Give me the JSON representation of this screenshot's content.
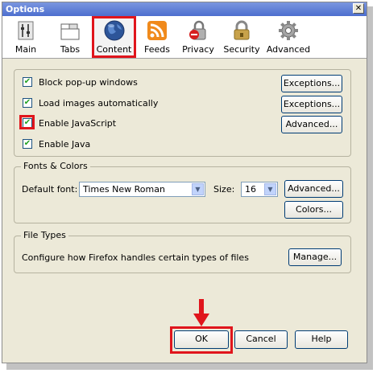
{
  "window": {
    "title": "Options",
    "close_glyph": "✕"
  },
  "toolbar": {
    "panes": [
      {
        "label": "Main",
        "icon": "main-icon"
      },
      {
        "label": "Tabs",
        "icon": "tabs-icon"
      },
      {
        "label": "Content",
        "icon": "content-icon",
        "selected": true
      },
      {
        "label": "Feeds",
        "icon": "feeds-icon"
      },
      {
        "label": "Privacy",
        "icon": "privacy-icon"
      },
      {
        "label": "Security",
        "icon": "security-icon"
      },
      {
        "label": "Advanced",
        "icon": "advanced-icon"
      }
    ]
  },
  "content": {
    "checkboxes": [
      {
        "label": "Block pop-up windows",
        "checked": true
      },
      {
        "label": "Load images automatically",
        "checked": true
      },
      {
        "label": "Enable JavaScript",
        "checked": true
      },
      {
        "label": "Enable Java",
        "checked": true
      }
    ],
    "buttons": {
      "exceptions1": "Exceptions...",
      "exceptions2": "Exceptions...",
      "advanced": "Advanced..."
    }
  },
  "fonts": {
    "legend": "Fonts & Colors",
    "default_font_label": "Default font:",
    "default_font_value": "Times New Roman",
    "size_label": "Size:",
    "size_value": "16",
    "advanced": "Advanced...",
    "colors": "Colors..."
  },
  "file_types": {
    "legend": "File Types",
    "description": "Configure how Firefox handles certain types of files",
    "manage": "Manage..."
  },
  "dialog": {
    "ok": "OK",
    "cancel": "Cancel",
    "help": "Help"
  },
  "colors": {
    "highlight": "#e0151c",
    "title_bar": "#5a7edc",
    "dialog_bg": "#ece9d8"
  }
}
